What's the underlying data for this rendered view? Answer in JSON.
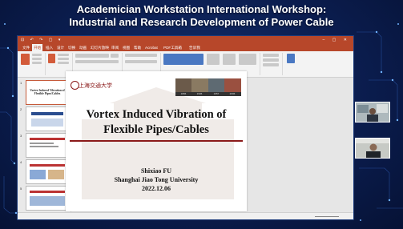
{
  "banner": {
    "line1": "Academician Workstation International Workshop:",
    "line2": "Industrial and Research Development of Power Cable"
  },
  "app": {
    "accent_color": "#b7472a",
    "title_icons": "⊡ ↶ ↷ ▢ ▾",
    "window_controls": "‒ ▢ ✕",
    "tabs": [
      "文件",
      "开始",
      "插入",
      "设计",
      "切换",
      "动画",
      "幻灯片放映",
      "审阅",
      "视图",
      "帮助",
      "Acrobat",
      "PDF工具箱",
      "告诉我"
    ],
    "active_tab": 1
  },
  "thumbnails": {
    "numbers": [
      "1",
      "2",
      "3",
      "4",
      "5"
    ],
    "first_title": "Vortex Induced Vibration of Flexible Pipes/Cables"
  },
  "slide": {
    "logo_text": "上海交通大学",
    "photo_years": [
      "1896",
      "1936",
      "1957",
      "2006"
    ],
    "title": "Vortex Induced Vibration of Flexible Pipes/Cables",
    "author": "Shixiao FU",
    "institution": "Shanghai Jiao Tong University",
    "date": "2022.12.06",
    "rule_color": "#8b1a1a"
  }
}
